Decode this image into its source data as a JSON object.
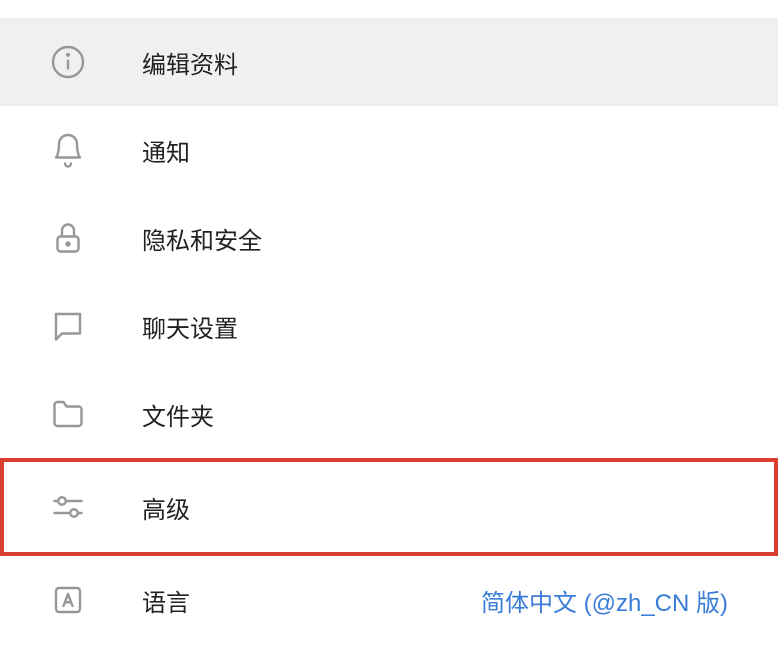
{
  "menu": {
    "items": [
      {
        "label": "编辑资料",
        "value": ""
      },
      {
        "label": "通知",
        "value": ""
      },
      {
        "label": "隐私和安全",
        "value": ""
      },
      {
        "label": "聊天设置",
        "value": ""
      },
      {
        "label": "文件夹",
        "value": ""
      },
      {
        "label": "高级",
        "value": ""
      },
      {
        "label": "语言",
        "value": "简体中文 (@zh_CN 版)"
      }
    ]
  },
  "colors": {
    "highlight": "#d93e2e",
    "link": "#3a7dd9",
    "icon": "#979797"
  }
}
